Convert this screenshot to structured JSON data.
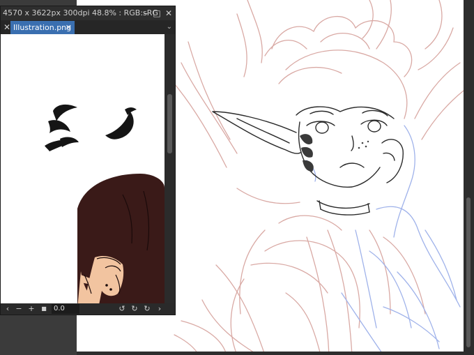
{
  "window": {
    "title": "4570 x 3622px 300dpi 48.8% : RGB:sRG",
    "minimize_glyph": "–",
    "maximize_glyph": "□",
    "close_glyph": "✕"
  },
  "tabs": {
    "close_glyph": "✕",
    "active_label": "Illustration.png",
    "active_close_glyph": "✕",
    "menu_glyph": "⌄"
  },
  "navigator": {
    "zoom_out_glyph": "−",
    "zoom_in_glyph": "+",
    "square_glyph": "■",
    "zoom_value": "0.0",
    "rotate_left_glyph": "↺",
    "rotate_right_glyph": "↻",
    "reset_glyph": "↻"
  },
  "colors": {
    "sketch_red": "#d9a9a4",
    "sketch_blue": "#9fb2ea",
    "lineart": "#2a2a2a",
    "hair_brown": "#3a1a18",
    "skin": "#f2c4a0",
    "tab_accent": "#3a6fb0"
  }
}
